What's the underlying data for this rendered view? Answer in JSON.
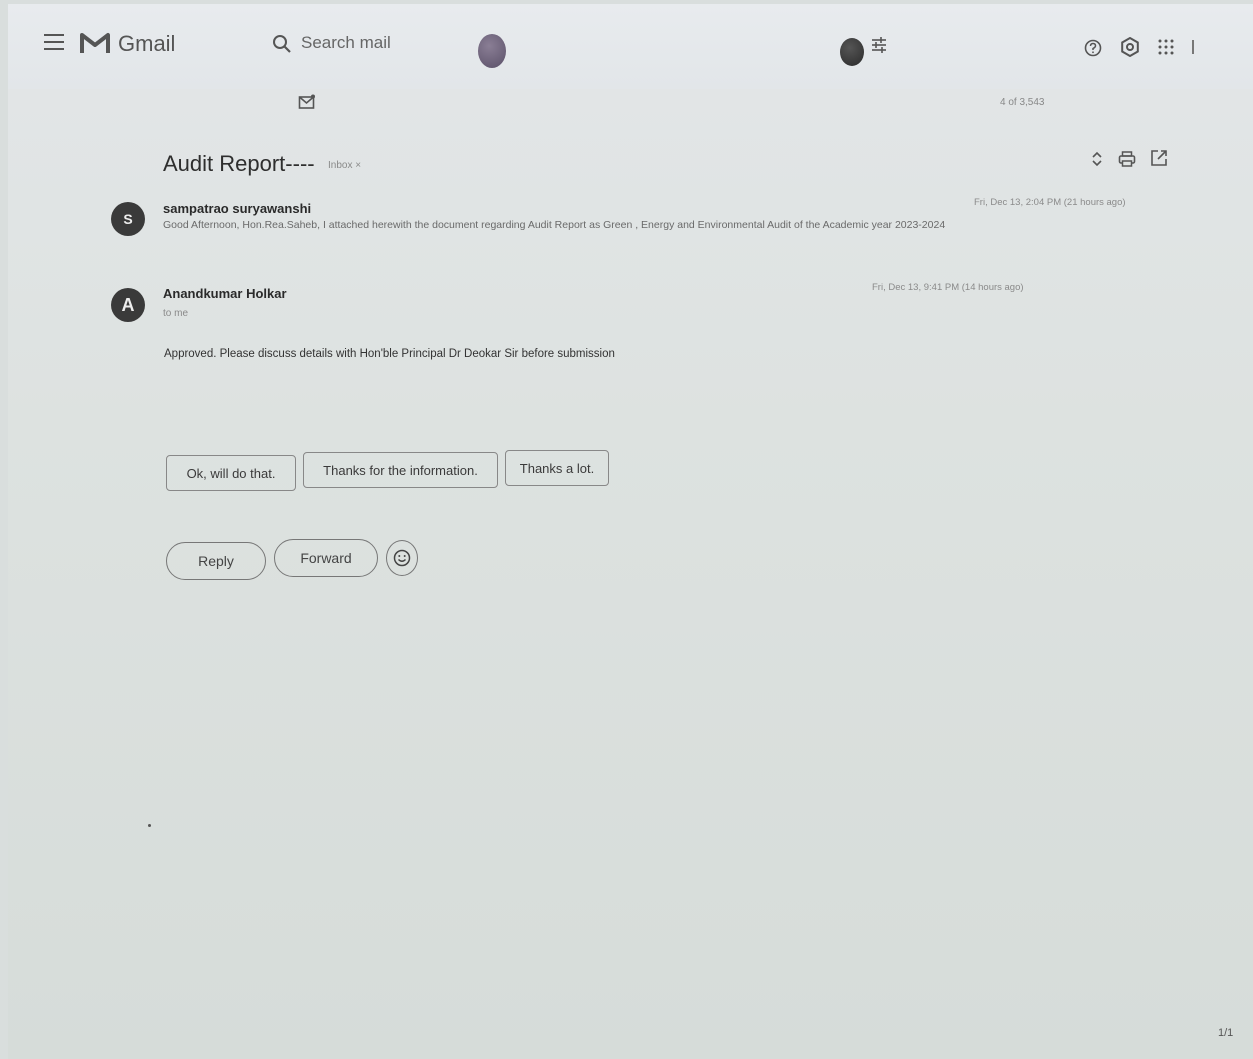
{
  "header": {
    "app_name": "Gmail",
    "search_placeholder": "Search mail"
  },
  "toolbar": {
    "pager": "4 of 3,543"
  },
  "thread": {
    "subject": "Audit Report----",
    "label": "Inbox ×",
    "messages": [
      {
        "avatar_letter": "S",
        "sender": "sampatrao suryawanshi",
        "date": "Fri, Dec 13, 2:04 PM (21 hours ago)",
        "snippet": "Good Afternoon, Hon.Rea.Saheb, I attached herewith the document regarding Audit Report as Green , Energy and Environmental Audit of the Academic year 2023-2024"
      },
      {
        "avatar_letter": "A",
        "sender": "Anandkumar Holkar",
        "recipient": "to me",
        "date": "Fri, Dec 13, 9:41 PM (14 hours ago)",
        "body": "Approved. Please discuss details with Hon'ble Principal Dr Deokar Sir before submission"
      }
    ]
  },
  "smart_replies": [
    "Ok, will do that.",
    "Thanks for the information.",
    "Thanks a lot."
  ],
  "actions": {
    "reply": "Reply",
    "forward": "Forward"
  },
  "footer": {
    "page": "1/1"
  }
}
